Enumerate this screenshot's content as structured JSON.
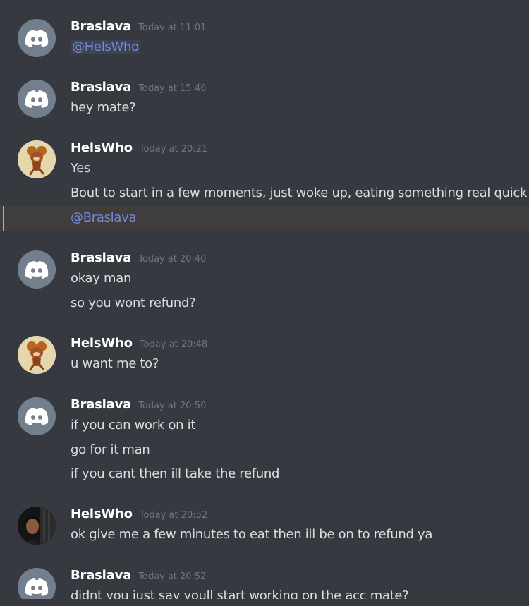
{
  "colors": {
    "background": "#36393f",
    "username": "#ffffff",
    "timestamp": "#72767d",
    "text": "#dcddde",
    "mention": "#7289da",
    "highlight_bar": "#faa61a",
    "highlight_bg": "#3f3e3d"
  },
  "messages": [
    {
      "author": "Braslava",
      "avatar": "discord-logo-icon",
      "timestamp": "Today at 11:01",
      "lines": [
        "@HelsWho"
      ]
    },
    {
      "author": "Braslava",
      "avatar": "discord-logo-icon",
      "timestamp": "Today at 15:46",
      "lines": [
        "hey mate?"
      ]
    },
    {
      "author": "HelsWho",
      "avatar": "jerry-mouse-avatar",
      "timestamp": "Today at 20:21",
      "lines": [
        "Yes",
        "Bout to start in a few moments, just woke up, eating something real quick",
        "@Braslava"
      ]
    },
    {
      "author": "Braslava",
      "avatar": "discord-logo-icon",
      "timestamp": "Today at 20:40",
      "lines": [
        "okay man",
        "so you wont refund?"
      ]
    },
    {
      "author": "HelsWho",
      "avatar": "jerry-mouse-avatar",
      "timestamp": "Today at 20:48",
      "lines": [
        "u want me to?"
      ]
    },
    {
      "author": "Braslava",
      "avatar": "discord-logo-icon",
      "timestamp": "Today at 20:50",
      "lines": [
        "if you can work on it",
        "go for it man",
        "if you cant then ill take the refund"
      ]
    },
    {
      "author": "HelsWho",
      "avatar": "person-photo-avatar",
      "timestamp": "Today at 20:52",
      "lines": [
        "ok give me a few minutes to eat then ill be on to refund ya"
      ]
    },
    {
      "author": "Braslava",
      "avatar": "discord-logo-icon",
      "timestamp": "Today at 20:52",
      "lines": [
        "didnt you just say youll start working on the acc mate?"
      ]
    }
  ]
}
